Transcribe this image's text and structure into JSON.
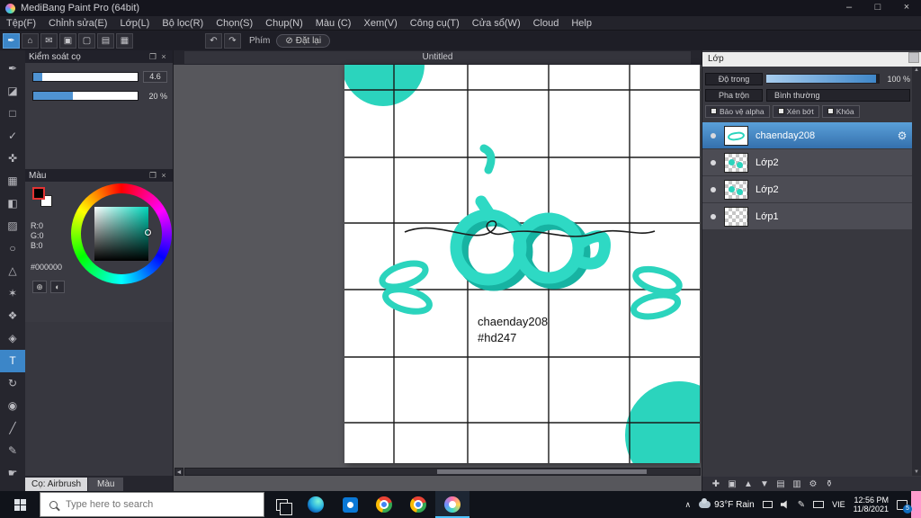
{
  "window": {
    "title": "MediBang Paint Pro (64bit)",
    "minimize": "–",
    "maximize": "□",
    "close": "×"
  },
  "menu": {
    "items": [
      "Tệp(F)",
      "Chỉnh sửa(E)",
      "Lớp(L)",
      "Bộ lọc(R)",
      "Chọn(S)",
      "Chụp(N)",
      "Màu (C)",
      "Xem(V)",
      "Công cụ(T)",
      "Cửa sổ(W)",
      "Cloud",
      "Help"
    ]
  },
  "toolbar": {
    "icons": [
      {
        "name": "brush",
        "glyph": "✒"
      },
      {
        "name": "save",
        "glyph": "⌂"
      },
      {
        "name": "chat",
        "glyph": "✉"
      },
      {
        "name": "palette",
        "glyph": "▣"
      },
      {
        "name": "page",
        "glyph": "▢"
      },
      {
        "name": "list",
        "glyph": "▤"
      },
      {
        "name": "grid",
        "glyph": "▦"
      }
    ],
    "undo": "↶",
    "redo": "↷",
    "phim": "Phím",
    "reset_icon": "⊘",
    "reset": "Đặt lại"
  },
  "tools": [
    {
      "name": "pen",
      "glyph": "✒"
    },
    {
      "name": "eraser",
      "glyph": "◪"
    },
    {
      "name": "rect",
      "glyph": "□"
    },
    {
      "name": "check",
      "glyph": "✓"
    },
    {
      "name": "move",
      "glyph": "✜"
    },
    {
      "name": "select",
      "glyph": "▦"
    },
    {
      "name": "bucket",
      "glyph": "◧"
    },
    {
      "name": "gradient",
      "glyph": "▨"
    },
    {
      "name": "lasso",
      "glyph": "○"
    },
    {
      "name": "polygon",
      "glyph": "△"
    },
    {
      "name": "wand",
      "glyph": "✶"
    },
    {
      "name": "pattern",
      "glyph": "❖"
    },
    {
      "name": "stamp",
      "glyph": "◈"
    },
    {
      "name": "text",
      "glyph": "T"
    },
    {
      "name": "rotate",
      "glyph": "↻"
    },
    {
      "name": "eyedropper",
      "glyph": "◉"
    },
    {
      "name": "line",
      "glyph": "╱"
    },
    {
      "name": "draw",
      "glyph": "✎"
    },
    {
      "name": "hand",
      "glyph": "☛"
    }
  ],
  "brush_panel": {
    "title": "Kiểm soát cọ",
    "popout": "❐",
    "close": "×",
    "size_value": "4.6",
    "opacity_value": "20 %"
  },
  "color_panel": {
    "title": "Màu",
    "popout": "❐",
    "close": "×",
    "r": "R:0",
    "g": "G:0",
    "b": "B:0",
    "hex": "#000000",
    "btn1": "⊕",
    "btn2": "◐"
  },
  "bottom_tabs": {
    "brush": "Cọ: Airbrush",
    "color": "Màu"
  },
  "canvas": {
    "tab": "Untitled",
    "text1": "chaenday208",
    "text2": "#hd247",
    "teal": "#2bd4bd"
  },
  "layers": {
    "title": "Lớp",
    "opacity_label": "Độ trong",
    "opacity_value": "100 %",
    "blend_label": "Pha trộn",
    "blend_value": "Bình thường",
    "check1": "Bảo vệ alpha",
    "check2": "Xén bớt",
    "check3": "Khóa",
    "rows": [
      {
        "name": "chaenday208",
        "selected": true
      },
      {
        "name": "Lớp2"
      },
      {
        "name": "Lớp2"
      },
      {
        "name": "Lớp1"
      }
    ],
    "gear": "⚙",
    "bottom_icons": [
      {
        "name": "new-layer",
        "glyph": "✚"
      },
      {
        "name": "duplicate-layer",
        "glyph": "▣"
      },
      {
        "name": "layer-up",
        "glyph": "▲"
      },
      {
        "name": "layer-down",
        "glyph": "▼"
      },
      {
        "name": "new-folder",
        "glyph": "▤"
      },
      {
        "name": "merge-layer",
        "glyph": "▥"
      },
      {
        "name": "layer-settings",
        "glyph": "⚙"
      },
      {
        "name": "delete-layer",
        "glyph": "⚱"
      }
    ]
  },
  "taskbar": {
    "search_placeholder": "Type here to search",
    "weather": "93°F Rain",
    "language": "VIE",
    "time": "12:56 PM",
    "date": "11/8/2021",
    "badge": "5"
  },
  "ui": {
    "scroll_up": "▲",
    "scroll_down": "▼",
    "scroll_left": "◄"
  }
}
